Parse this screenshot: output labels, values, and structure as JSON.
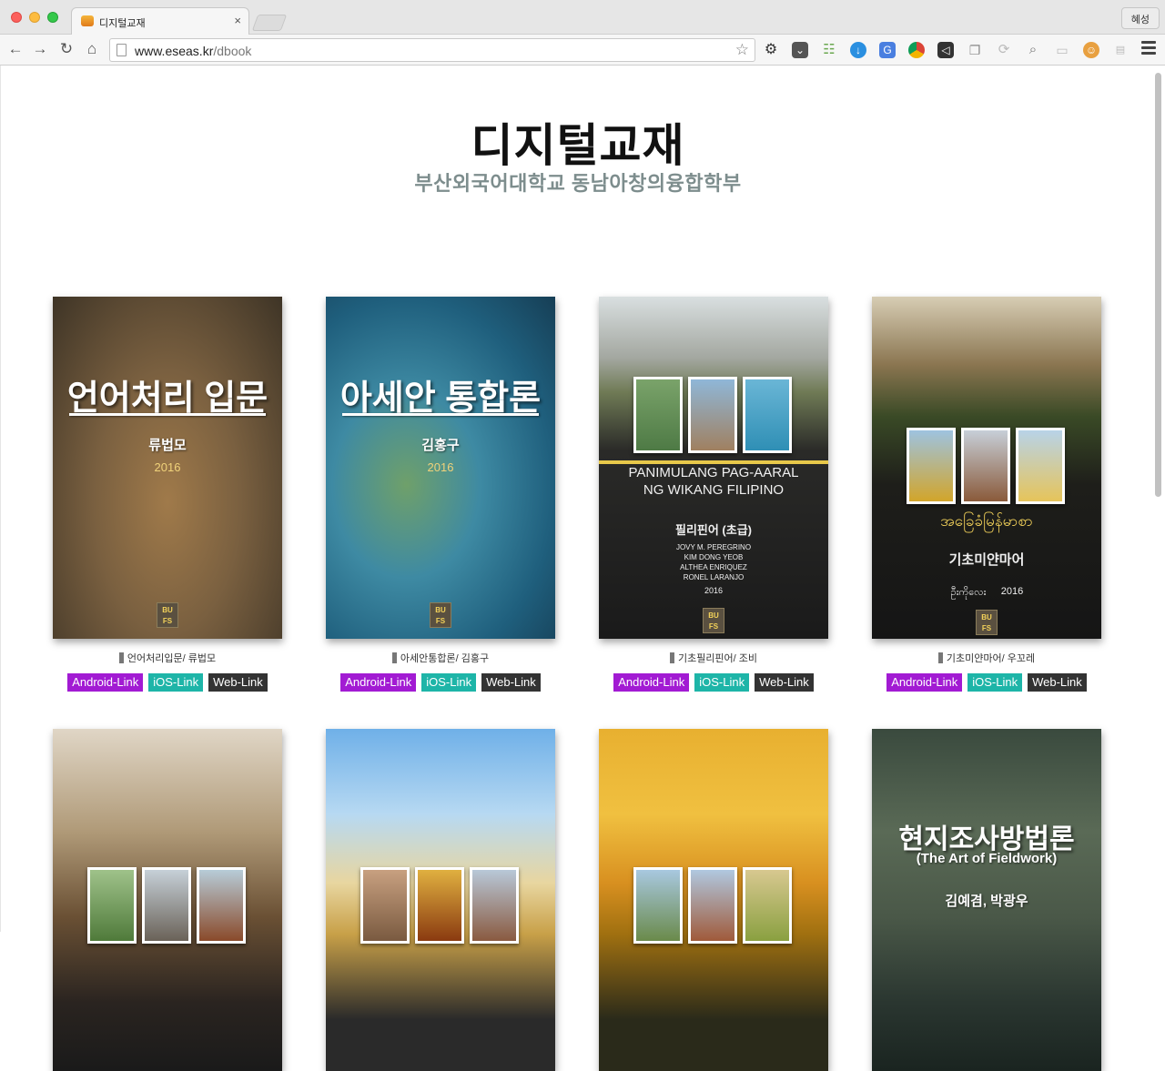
{
  "browser": {
    "tab_title": "디지털교재",
    "tab_close": "×",
    "profile": "혜성",
    "url_host": "www.eseas.kr",
    "url_path": "/dbook",
    "icons": [
      "back-icon",
      "forward-icon",
      "reload-icon",
      "home-icon",
      "page-icon",
      "bookmark-star-icon",
      "settings-gear-icon",
      "pocket-icon",
      "ladder-extension-icon",
      "download-icon",
      "translate-icon",
      "chrome-icon",
      "vscode-icon",
      "copy-icon",
      "sync-icon",
      "search-icon",
      "cast-icon",
      "cat-extension-icon",
      "text-extension-icon",
      "menu-icon"
    ]
  },
  "page": {
    "title": "디지털교재",
    "subtitle": "부산외국어대학교  동남아창의융합학부"
  },
  "link_labels": {
    "android": "Android-Link",
    "ios": "iOS-Link",
    "web": "Web-Link"
  },
  "colors": {
    "android": "#a21bd3",
    "ios": "#1eb5a8",
    "web": "#333333",
    "subtitle": "#7d8d8d"
  },
  "books": [
    {
      "caption": "언어처리입문/ 류법모",
      "cover_title": "언어처리 입문",
      "cover_author": "류법모",
      "cover_year": "2016",
      "badge": "BU FS"
    },
    {
      "caption": "아세안통합론/ 김홍구",
      "cover_title": "아세안 통합론",
      "cover_author": "김홍구",
      "cover_year": "2016",
      "badge": "BU FS"
    },
    {
      "caption": "기초필리핀어/ 조비",
      "cover_title": "PANIMULANG PAG-AARAL NG WIKANG FILIPINO",
      "cover_subtitle": "필리핀어 (초급)",
      "cover_authors": "JOVY M. PEREGRINO\nKIM DONG YEOB\nALTHEA ENRIQUEZ\nRONEL LARANJO",
      "cover_year": "2016",
      "badge": "BU FS"
    },
    {
      "caption": "기초미얀마어/ 우꼬레",
      "cover_title": "အခြေခံမြန်မာစာ",
      "cover_subtitle": "기초미얀마어",
      "cover_author": "ဦးကိုလေး",
      "cover_year": "2016",
      "badge": "BU FS"
    },
    {
      "caption": "",
      "cover_title": ""
    },
    {
      "caption": "",
      "cover_title": ""
    },
    {
      "caption": "",
      "cover_title": ""
    },
    {
      "caption": "",
      "cover_title": "현지조사방법론",
      "cover_subtitle": "(The Art of Fieldwork)",
      "cover_author": "김예겸, 박광우"
    }
  ]
}
